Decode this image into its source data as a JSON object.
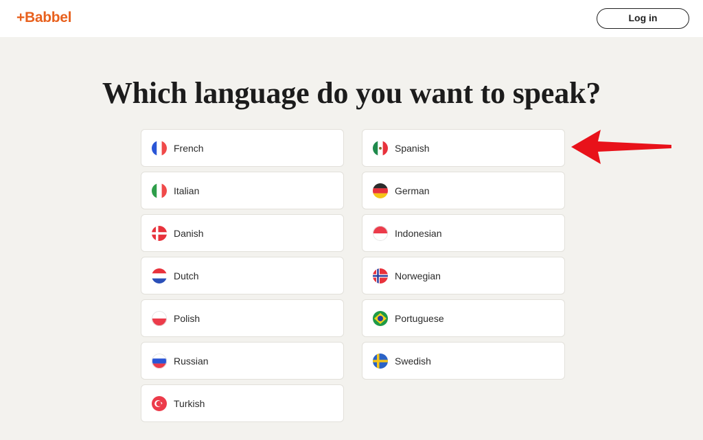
{
  "header": {
    "logo": "+Babbel",
    "login_label": "Log in"
  },
  "main": {
    "heading": "Which language do you want to speak?",
    "languages_left": [
      {
        "label": "French",
        "flag": "france-flag-icon"
      },
      {
        "label": "Italian",
        "flag": "italy-flag-icon"
      },
      {
        "label": "Danish",
        "flag": "denmark-flag-icon"
      },
      {
        "label": "Dutch",
        "flag": "netherlands-flag-icon"
      },
      {
        "label": "Polish",
        "flag": "poland-flag-icon"
      },
      {
        "label": "Russian",
        "flag": "russia-flag-icon"
      },
      {
        "label": "Turkish",
        "flag": "turkey-flag-icon"
      }
    ],
    "languages_right": [
      {
        "label": "Spanish",
        "flag": "mexico-flag-icon"
      },
      {
        "label": "German",
        "flag": "germany-flag-icon"
      },
      {
        "label": "Indonesian",
        "flag": "indonesia-flag-icon"
      },
      {
        "label": "Norwegian",
        "flag": "norway-flag-icon"
      },
      {
        "label": "Portuguese",
        "flag": "brazil-flag-icon"
      },
      {
        "label": "Swedish",
        "flag": "sweden-flag-icon"
      }
    ]
  },
  "annotation": {
    "icon": "red-arrow-icon",
    "color": "#e8121a"
  },
  "colors": {
    "brand": "#e8611e",
    "background": "#f3f2ee"
  }
}
